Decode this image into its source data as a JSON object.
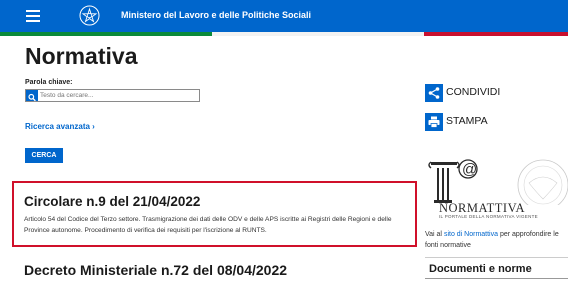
{
  "header": {
    "ministry_name": "Ministero del Lavoro e delle Politiche Sociali",
    "menu_icon": "hamburger-icon",
    "emblem_icon": "italian-republic-emblem-icon"
  },
  "colors": {
    "primary": "#0066cc",
    "flag_green": "#0a8a3a",
    "flag_white": "#f2f2f2",
    "flag_red": "#c8102e",
    "highlight_border": "#d0102a"
  },
  "page": {
    "title": "Normativa"
  },
  "search": {
    "label": "Parola chiave:",
    "placeholder": "Testo da cercare...",
    "value": "",
    "advanced_link": "Ricerca avanzata",
    "advanced_chevron": "›",
    "submit_label": "CERCA"
  },
  "results": [
    {
      "title": "Circolare n.9 del 21/04/2022",
      "description": "Articolo 54 del Codice del Terzo settore. Trasmigrazione dei dati delle ODV e delle APS iscritte ai Registri delle Regioni e delle Province autonome. Procedimento di verifica dei requisiti per l'iscrizione al RUNTS.",
      "highlighted": true
    },
    {
      "title": "Decreto Ministeriale n.72 del 08/04/2022",
      "highlighted": false
    }
  ],
  "sidebar": {
    "share_label": "CONDIVIDI",
    "share_icon": "share-icon",
    "print_label": "STAMPA",
    "print_icon": "print-icon",
    "normattiva": {
      "logo_text": "NORMATTIVA",
      "logo_subtitle": "IL PORTALE DELLA NORMATIVA VIGENTE",
      "text_before": "Vai al ",
      "link_text": "sito di Normattiva",
      "text_after": " per approfondire le fonti normative"
    },
    "section_heading": "Documenti e norme"
  }
}
